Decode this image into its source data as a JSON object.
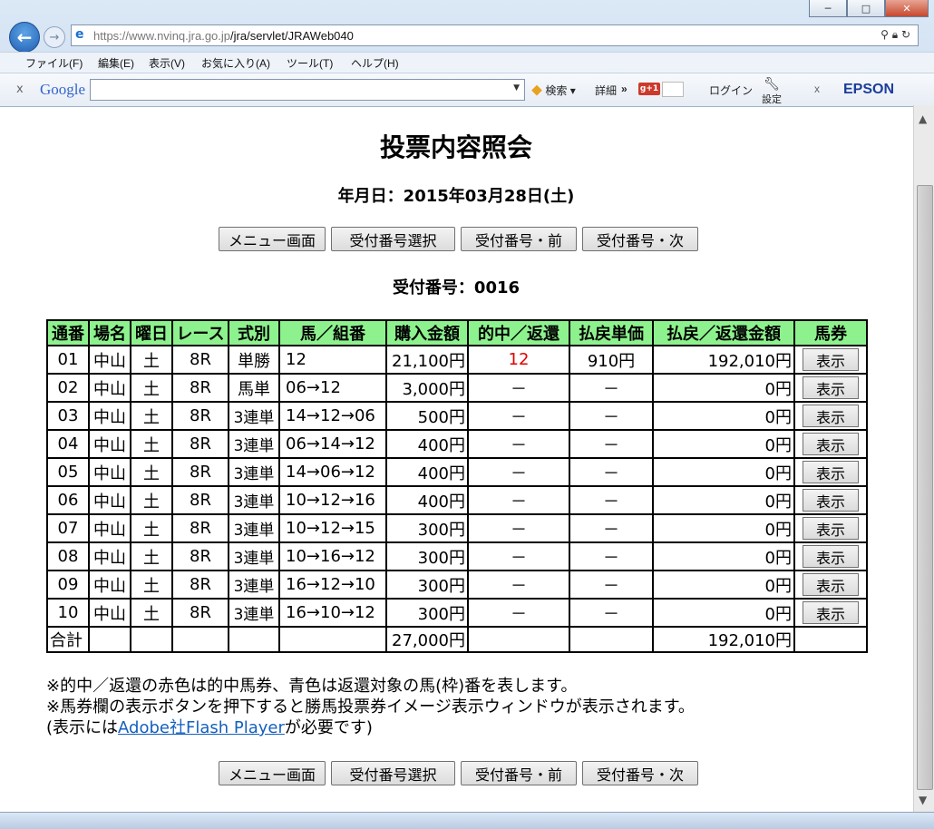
{
  "browser": {
    "url_host": "https://www.nvinq.jra.go.jp",
    "url_path": "/jra/servlet/JRAWeb040",
    "menu": [
      "ファイル(F)",
      "編集(E)",
      "表示(V)",
      "お気に入り(A)",
      "ツール(T)",
      "ヘルプ(H)"
    ],
    "toolbar": {
      "close_x": "x",
      "google": "Google",
      "search": "検索",
      "detail": "詳細",
      "chevron": "»",
      "gplus": "g+1",
      "login": "ログイン",
      "settings": "設定",
      "close_x2": "x",
      "epson": "EPSON"
    }
  },
  "page": {
    "title": "投票内容照会",
    "date_line": "年月日：2015年03月28日(土)",
    "buttons": [
      "メニュー画面",
      "受付番号選択",
      "受付番号・前",
      "受付番号・次"
    ],
    "receipt_line": "受付番号：0016"
  },
  "table": {
    "headers": [
      "通番",
      "場名",
      "曜日",
      "レース",
      "式別",
      "馬／組番",
      "購入金額",
      "的中／返還",
      "払戻単価",
      "払戻／返還金額",
      "馬券"
    ],
    "rows": [
      [
        "01",
        "中山",
        "土",
        "8R",
        "単勝",
        "12",
        "21,100円",
        "12",
        "910円",
        "192,010円",
        "表示"
      ],
      [
        "02",
        "中山",
        "土",
        "8R",
        "馬単",
        "06→12",
        "3,000円",
        "－",
        "－",
        "0円",
        "表示"
      ],
      [
        "03",
        "中山",
        "土",
        "8R",
        "3連単",
        "14→12→06",
        "500円",
        "－",
        "－",
        "0円",
        "表示"
      ],
      [
        "04",
        "中山",
        "土",
        "8R",
        "3連単",
        "06→14→12",
        "400円",
        "－",
        "－",
        "0円",
        "表示"
      ],
      [
        "05",
        "中山",
        "土",
        "8R",
        "3連単",
        "14→06→12",
        "400円",
        "－",
        "－",
        "0円",
        "表示"
      ],
      [
        "06",
        "中山",
        "土",
        "8R",
        "3連単",
        "10→12→16",
        "400円",
        "－",
        "－",
        "0円",
        "表示"
      ],
      [
        "07",
        "中山",
        "土",
        "8R",
        "3連単",
        "10→12→15",
        "300円",
        "－",
        "－",
        "0円",
        "表示"
      ],
      [
        "08",
        "中山",
        "土",
        "8R",
        "3連単",
        "10→16→12",
        "300円",
        "－",
        "－",
        "0円",
        "表示"
      ],
      [
        "09",
        "中山",
        "土",
        "8R",
        "3連単",
        "16→12→10",
        "300円",
        "－",
        "－",
        "0円",
        "表示"
      ],
      [
        "10",
        "中山",
        "土",
        "8R",
        "3連単",
        "16→10→12",
        "300円",
        "－",
        "－",
        "0円",
        "表示"
      ]
    ],
    "total_label": "合計",
    "total_purchase": "27,000円",
    "total_payout": "192,010円"
  },
  "notes": {
    "line1": "※的中／返還の赤色は的中馬券、青色は返還対象の馬(枠)番を表します。",
    "line2": "※馬券欄の表示ボタンを押下すると勝馬投票券イメージ表示ウィンドウが表示されます。",
    "line3_pre": "(表示には",
    "line3_link": "Adobe社Flash Player",
    "line3_post": "が必要です)"
  },
  "colors": {
    "header_bg": "#8df28d",
    "hit_red": "#e00000",
    "link": "#1560bd"
  }
}
